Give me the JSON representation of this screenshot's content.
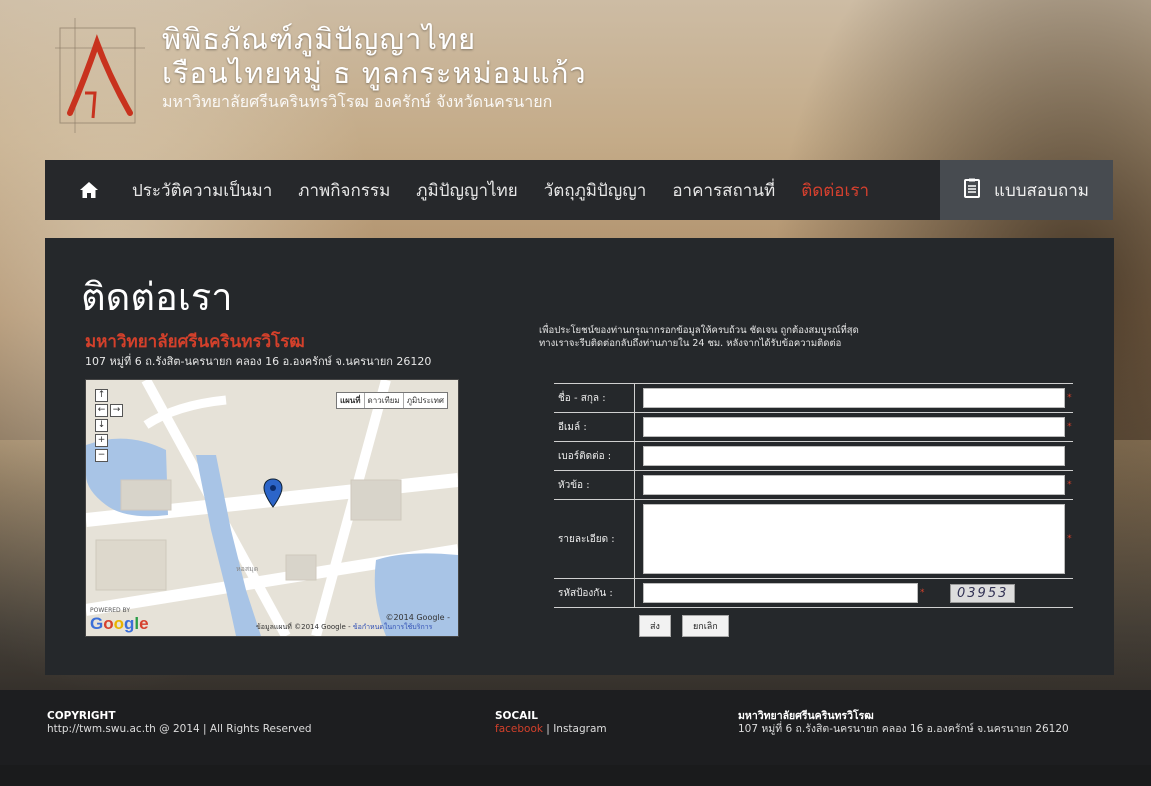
{
  "header": {
    "title_line1": "พิพิธภัณฑ์ภูมิปัญญาไทย",
    "title_line2": "เรือนไทยหมู่ ธ ทูลกระหม่อมแก้ว",
    "title_line3": "มหาวิทยาลัยศรีนครินทรวิโรฒ องครักษ์ จังหวัดนครนายก"
  },
  "nav": {
    "home_icon": "home-icon",
    "items": [
      {
        "label": "ประวัติความเป็นมา"
      },
      {
        "label": "ภาพกิจกรรม"
      },
      {
        "label": "ภูมิปัญญาไทย"
      },
      {
        "label": "วัตถุภูมิปัญญา"
      },
      {
        "label": "อาคารสถานที่"
      },
      {
        "label": "ติดต่อเรา"
      }
    ],
    "active_color": "#d6402e",
    "survey_label": "แบบสอบถาม",
    "survey_icon": "clipboard-icon"
  },
  "contact": {
    "page_title": "ติดต่อเรา",
    "university": "มหาวิทยาลัยศรีนครินทรวิโรฒ",
    "address": "107 หมู่ที่ 6 ถ.รังสิต-นครนายก คลอง 16 อ.องครักษ์ จ.นครนายก 26120",
    "intro_line1": "เพื่อประโยชน์ของท่านกรุณากรอกข้อมูลให้ครบถ้วน ชัดเจน ถูกต้องสมบูรณ์ที่สุด",
    "intro_line2": "ทางเราจะรีบติดต่อกลับถึงท่านภายใน 24 ชม. หลังจากได้รับข้อความติดต่อ"
  },
  "map": {
    "type_buttons": [
      "แผนที่",
      "ดาวเทียม",
      "ภูมิประเทศ"
    ],
    "label_building": "หอสมุด",
    "copyright": "©2014 Google -",
    "terms_prefix": "ข้อมูลแผนที่ ©2014 Google -",
    "terms_link": "ข้อกำหนดในการใช้บริการ",
    "powered_by": "POWERED BY",
    "google": "Google"
  },
  "form": {
    "name_label": "ชื่อ - สกุล :",
    "email_label": "อีเมล์ :",
    "phone_label": "เบอร์ติดต่อ :",
    "subject_label": "หัวข้อ :",
    "detail_label": "รายละเอียด :",
    "captcha_label": "รหัสป้องกัน :",
    "captcha_text": "03953",
    "required_mark": "*",
    "submit_label": "ส่ง",
    "cancel_label": "ยกเลิก"
  },
  "footer": {
    "copyright_head": "COPYRIGHT",
    "copyright_text": "http://twm.swu.ac.th @ 2014 | All Rights Reserved",
    "social_head": "SOCAIL",
    "facebook": "facebook",
    "sep": " | ",
    "instagram": "Instagram",
    "uni_head": "มหาวิทยาลัยศรีนครินทรวิโรฒ",
    "uni_addr": "107 หมู่ที่ 6 ถ.รังสิต-นครนายก คลอง 16 อ.องครักษ์ จ.นครนายก 26120"
  }
}
